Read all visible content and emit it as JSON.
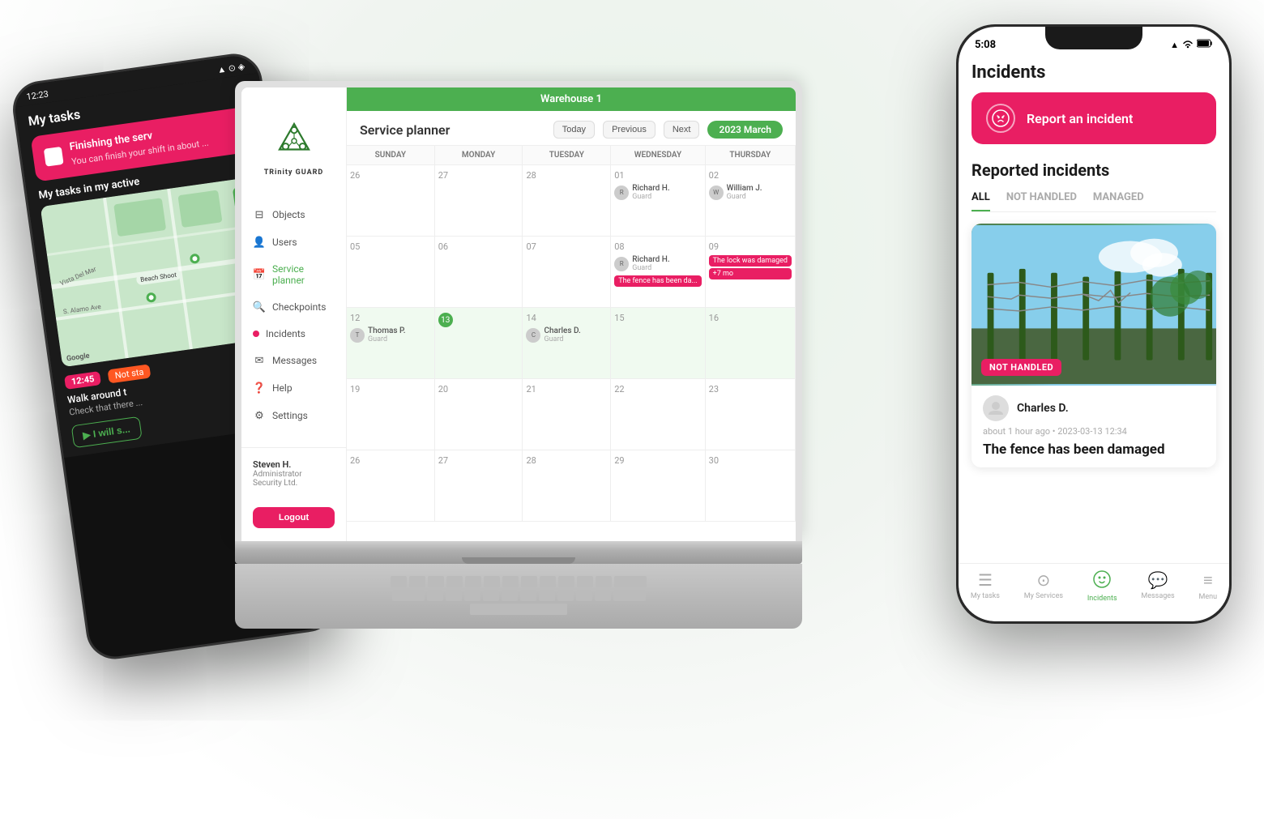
{
  "app": {
    "title": "TRinity GUARD"
  },
  "android_phone": {
    "statusbar": {
      "time": "12:23",
      "icons": "▲ ⊙ ◈"
    },
    "my_tasks_label": "My tasks",
    "task_card": {
      "text": "Finishing the serv",
      "subtext": "You can finish your shift in about ..."
    },
    "active_section": "My tasks in my active",
    "task_time": "12:45",
    "task_status": "Not sta",
    "task_desc": "Walk around t",
    "task_sub": "Check that there ...",
    "reply_label": "I will s..."
  },
  "laptop": {
    "warehouse": "Warehouse 1",
    "planner_title": "Service planner",
    "nav": {
      "today": "Today",
      "previous": "Previous",
      "next": "Next"
    },
    "date_badge": "2023 March",
    "sidebar": {
      "items": [
        {
          "label": "Objects",
          "icon": "⊟"
        },
        {
          "label": "Users",
          "icon": "👤"
        },
        {
          "label": "Service planner",
          "icon": "📅"
        },
        {
          "label": "Checkpoints",
          "icon": "🔍"
        },
        {
          "label": "Incidents",
          "icon": "🔴"
        },
        {
          "label": "Messages",
          "icon": "✉"
        },
        {
          "label": "Help",
          "icon": "❓"
        },
        {
          "label": "Settings",
          "icon": "⚙"
        }
      ],
      "user": {
        "name": "Steven H.",
        "role": "Administrator",
        "company": "Security Ltd."
      },
      "logout": "Logout"
    },
    "calendar": {
      "days": [
        "SUNDAY",
        "MONDAY",
        "TUESDAY",
        "WEDNESDAY",
        "THURSDAY"
      ],
      "weeks": [
        {
          "days": [
            {
              "num": "26",
              "entries": []
            },
            {
              "num": "27",
              "entries": []
            },
            {
              "num": "28",
              "entries": []
            },
            {
              "num": "01",
              "entries": [
                {
                  "name": "Richard H.",
                  "role": "Guard"
                }
              ]
            },
            {
              "num": "02",
              "entries": [
                {
                  "name": "William J.",
                  "role": "Guard"
                }
              ]
            }
          ]
        },
        {
          "days": [
            {
              "num": "05",
              "entries": []
            },
            {
              "num": "06",
              "entries": []
            },
            {
              "num": "07",
              "entries": []
            },
            {
              "num": "08",
              "entries": [
                {
                  "name": "Richard H.",
                  "role": "Guard"
                },
                {
                  "incident": "The fence has been da..."
                }
              ]
            },
            {
              "num": "09",
              "entries": [
                {
                  "incident": "The lock was damaged"
                },
                {
                  "more": "+7 mo"
                }
              ]
            }
          ]
        },
        {
          "days": [
            {
              "num": "12",
              "entries": [
                {
                  "name": "Thomas P.",
                  "role": "Guard"
                }
              ]
            },
            {
              "num": "13",
              "entries": [],
              "today": true
            },
            {
              "num": "14",
              "entries": [
                {
                  "name": "Charles D.",
                  "role": "Guard"
                }
              ]
            },
            {
              "num": "15",
              "entries": []
            },
            {
              "num": "16",
              "entries": []
            }
          ]
        },
        {
          "days": [
            {
              "num": "19",
              "entries": []
            },
            {
              "num": "20",
              "entries": []
            },
            {
              "num": "21",
              "entries": []
            },
            {
              "num": "22",
              "entries": []
            },
            {
              "num": "23",
              "entries": []
            }
          ]
        },
        {
          "days": [
            {
              "num": "26",
              "entries": []
            },
            {
              "num": "27",
              "entries": []
            },
            {
              "num": "28",
              "entries": []
            },
            {
              "num": "29",
              "entries": []
            },
            {
              "num": "30",
              "entries": []
            }
          ]
        }
      ]
    }
  },
  "iphone": {
    "statusbar": {
      "time": "5:08",
      "signal": "▲",
      "wifi": "wifi",
      "battery": "▮"
    },
    "page_title": "Incidents",
    "report_btn_label": "Report an incident",
    "reported_incidents_title": "Reported incidents",
    "tabs": [
      {
        "label": "ALL",
        "active": true
      },
      {
        "label": "NOT HANDLED",
        "active": false
      },
      {
        "label": "MANAGED",
        "active": false
      }
    ],
    "incident": {
      "badge": "NOT HANDLED",
      "reporter_name": "Charles D.",
      "meta": "about 1 hour ago  •  2023-03-13 12:34",
      "description": "The fence has been damaged"
    },
    "tabbar": [
      {
        "label": "My tasks",
        "icon": "☰",
        "active": false
      },
      {
        "label": "My Services",
        "icon": "⊙",
        "active": false
      },
      {
        "label": "Incidents",
        "icon": "☹",
        "active": true
      },
      {
        "label": "Messages",
        "icon": "💬",
        "active": false
      },
      {
        "label": "Menu",
        "icon": "≡",
        "active": false
      }
    ]
  }
}
